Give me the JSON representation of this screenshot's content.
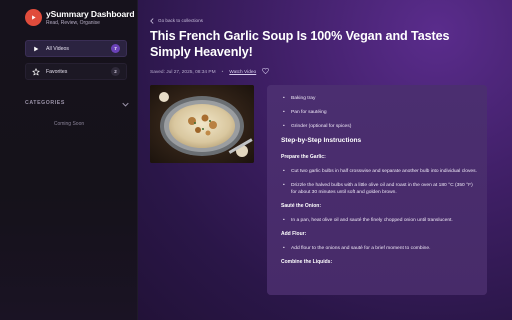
{
  "app": {
    "title": "ySummary Dashboard",
    "subtitle": "Read, Review, Organise"
  },
  "sidebar": {
    "items": [
      {
        "label": "All Videos",
        "count": "7",
        "icon": "play-icon",
        "active": true
      },
      {
        "label": "Favorites",
        "count": "2",
        "icon": "star-icon",
        "active": false
      }
    ],
    "categories_title": "CATEGORIES",
    "categories_empty": "Coming Soon"
  },
  "main": {
    "back_label": "Go back to collections",
    "title": "This French Garlic Soup Is 100% Vegan and Tastes Simply Heavenly!",
    "meta": {
      "saved": "Saved: Jul 27, 2025, 08:34 PM",
      "separator": "•",
      "watch_label": "Watch Video"
    },
    "content": {
      "equipment_items": [
        "Baking tray",
        "Pan for sautéing",
        "Grinder (optional for spices)"
      ],
      "steps_title": "Step-by-Step Instructions",
      "sections": [
        {
          "title": "Prepare the Garlic:",
          "items": [
            "Cut two garlic bulbs in half crosswise and separate another bulb into individual cloves.",
            "Drizzle the halved bulbs with a little olive oil and roast in the oven at 180 °C (350 °F) for about 30 minutes until soft and golden brown."
          ]
        },
        {
          "title": "Sauté the Onion:",
          "items": [
            "In a pan, heat olive oil and sauté the finely chopped onion until translucent."
          ]
        },
        {
          "title": "Add Flour:",
          "items": [
            "Add flour to the onions and sauté for a brief moment to combine."
          ]
        },
        {
          "title": "Combine the Liquids:",
          "items": []
        }
      ]
    }
  },
  "colors": {
    "accent": "#6b42b8",
    "logo": "#e04c3c",
    "main_bg": "#3f1f66",
    "sidebar_bg": "#16121c"
  }
}
